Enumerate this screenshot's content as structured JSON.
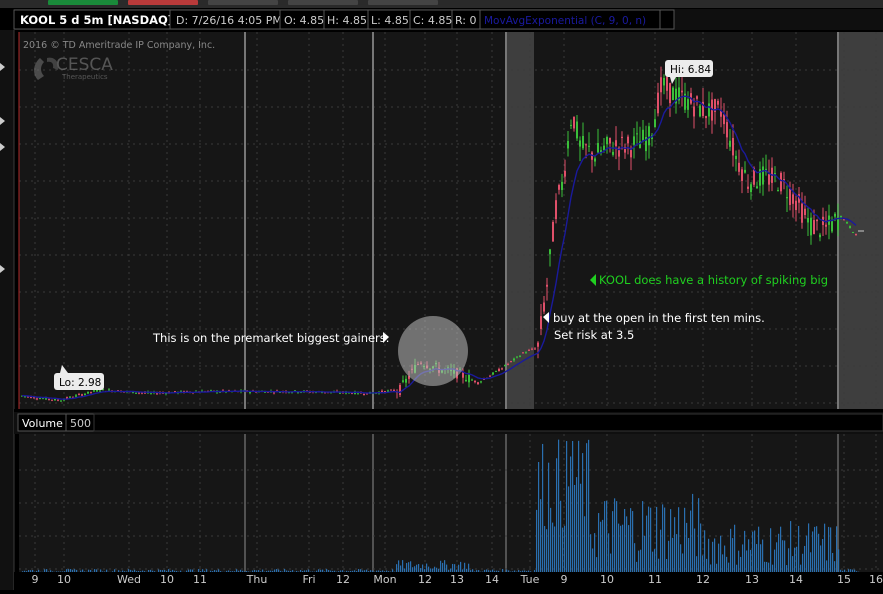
{
  "header": {
    "symbol_label": "KOOL 5 d 5m [NASDAQ]",
    "date_field": "D: 7/26/16 4:05 PM",
    "open_field": "O: 4.85",
    "high_field": "H: 4.85",
    "low_field": "L: 4.85",
    "close_field": "C: 4.85",
    "range_field": "R: 0",
    "study_label": "MovAvgExponential (C, 9, 0, n)"
  },
  "colors": {
    "background": "#000000",
    "panel": "#161616",
    "grid": "#3a3a3a",
    "up": "#3ac03a",
    "down": "#e0506a",
    "ema": "#1a1a9c",
    "volume": "#2a6fb0",
    "annotation_green": "#20d020",
    "premarket_shade": "#505050"
  },
  "watermark": {
    "copyright": "2016 © TD Ameritrade IP Company, Inc.",
    "logo_text": "CESCA",
    "logo_sub": "Therapeutics"
  },
  "chart_data": {
    "type": "candlestick",
    "symbol": "KOOL",
    "aggregation": "5 d 5m",
    "x_ticks": [
      "9",
      "10",
      "Wed",
      "10",
      "11",
      "Thu",
      "Fri",
      "12",
      "Mon",
      "12",
      "13",
      "14",
      "Tue",
      "9",
      "10",
      "11",
      "12",
      "13",
      "14",
      "15",
      "16"
    ],
    "ylim": [
      2.9,
      7.2
    ],
    "hi_marker": {
      "label": "Hi: 6.84",
      "value": 6.84
    },
    "lo_marker": {
      "label": "Lo: 2.98",
      "value": 2.98
    },
    "series": [
      {
        "name": "MovAvgExponential (C, 9, 0, n)",
        "type": "line"
      },
      {
        "name": "Volume",
        "type": "bar"
      }
    ],
    "last_price": 4.85
  },
  "annotations": {
    "premarket": "This is on the premarket biggest gainers.",
    "buy_line1": "buy at the open in the first ten mins.",
    "buy_line2": "Set risk at 3.5",
    "history": "KOOL does have a history of spiking big"
  },
  "volume_panel": {
    "title": "Volume",
    "value": "500"
  }
}
